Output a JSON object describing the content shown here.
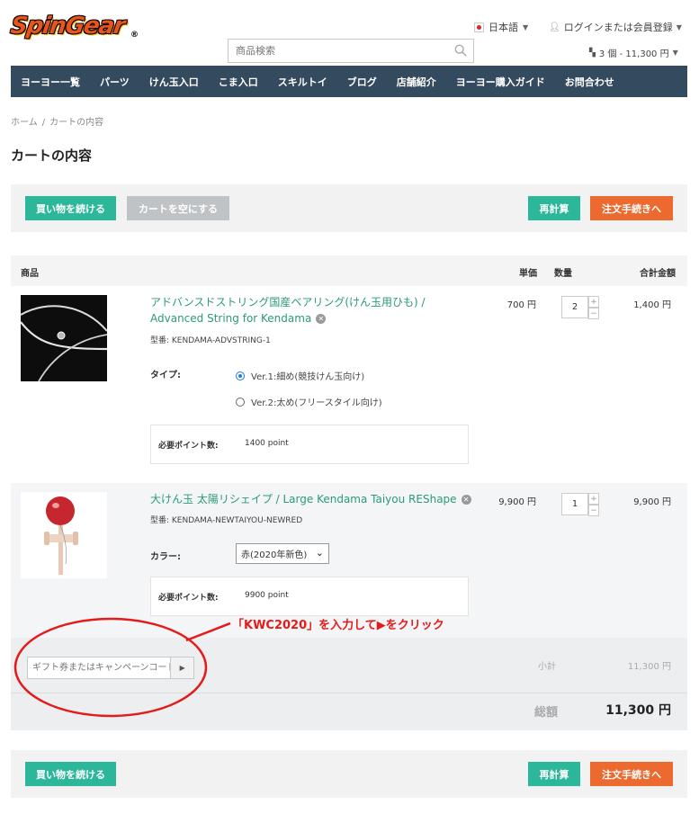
{
  "header": {
    "logo_text": "SpinGear",
    "language": "日本語",
    "login": "ログインまたは会員登録",
    "search_placeholder": "商品検索",
    "cart_summary": "3 個 - 11,300 円"
  },
  "nav": {
    "items": [
      "ヨーヨー一覧",
      "パーツ",
      "けん玉入口",
      "こま入口",
      "スキルトイ",
      "ブログ",
      "店舗紹介",
      "ヨーヨー購入ガイド",
      "お問合わせ"
    ]
  },
  "breadcrumb": {
    "home": "ホーム",
    "sep": "/",
    "current": "カートの内容"
  },
  "page_title": "カートの内容",
  "actions": {
    "continue": "買い物を続ける",
    "empty": "カートを空にする",
    "recalc": "再計算",
    "checkout": "注文手続きへ"
  },
  "table": {
    "headers": {
      "product": "商品",
      "unit_price": "単価",
      "qty": "数量",
      "total": "合計金額"
    }
  },
  "items": [
    {
      "name_line1": "アドバンスドストリング国産ベアリング(けん玉用ひも) /",
      "name_line2": "Advanced String for Kendama",
      "sku": "型番: KENDAMA-ADVSTRING-1",
      "option_label": "タイプ:",
      "options": [
        "Ver.1:細め(競技けん玉向け)",
        "Ver.2:太め(フリースタイル向け)"
      ],
      "selected_option": 0,
      "points_label": "必要ポイント数:",
      "points_value": "1400 point",
      "unit_price": "700 円",
      "qty": "2",
      "total": "1,400 円"
    },
    {
      "name": "大けん玉 太陽リシェイプ / Large Kendama Taiyou REShape",
      "sku": "型番: KENDAMA-NEWTAIYOU-NEWRED",
      "option_label": "カラー:",
      "selected_value": "赤(2020年新色)",
      "points_label": "必要ポイント数:",
      "points_value": "9900 point",
      "unit_price": "9,900 円",
      "qty": "1",
      "total": "9,900 円"
    }
  ],
  "coupon": {
    "placeholder": "ギフト券またはキャンペーンコード"
  },
  "summary": {
    "subtotal_label": "小計",
    "subtotal_value": "11,300 円",
    "total_label": "総額",
    "total_value": "11,300 円"
  },
  "annotation": {
    "text": "「KWC2020」を入力して▶をクリック"
  },
  "colors": {
    "accent_green": "#2db79a",
    "accent_orange": "#ec6a2f",
    "nav_bg": "#344a5e",
    "annotation_red": "#e41b1b"
  }
}
